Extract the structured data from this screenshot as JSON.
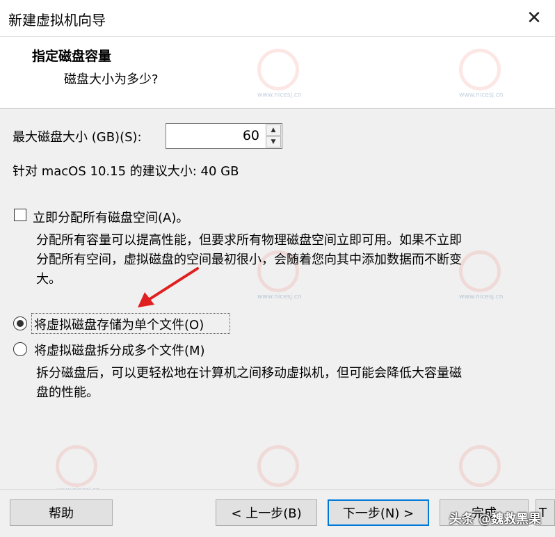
{
  "window": {
    "title": "新建虚拟机向导",
    "close_glyph": "✕"
  },
  "header": {
    "title": "指定磁盘容量",
    "subtitle": "磁盘大小为多少?"
  },
  "disk_size": {
    "label": "最大磁盘大小 (GB)(S):",
    "value": "60",
    "recommended": "针对 macOS 10.15 的建议大小: 40 GB"
  },
  "allocate": {
    "label": "立即分配所有磁盘空间(A)。",
    "checked": false,
    "description_line1": "分配所有容量可以提高性能，但要求所有物理磁盘空间立即可用。如果不立即",
    "description_line2": "分配所有空间，虚拟磁盘的空间最初很小，会随着您向其中添加数据而不断变",
    "description_line3": "大。"
  },
  "storage": {
    "single_label": "将虚拟磁盘存储为单个文件(O)",
    "split_label": "将虚拟磁盘拆分成多个文件(M)",
    "selected": "single",
    "split_desc_line1": "拆分磁盘后，可以更轻松地在计算机之间移动虚拟机，但可能会降低大容量磁",
    "split_desc_line2": "盘的性能。"
  },
  "footer": {
    "help": "帮助",
    "back": "< 上一步(B)",
    "next": "下一步(N) >",
    "finish": "完成",
    "cancel": "T",
    "watermark": "头条 @魏救黑果"
  },
  "site_watermark": "www.nicesj.cn",
  "colors": {
    "focus": "#0078d7",
    "arrow": "#e02020"
  }
}
